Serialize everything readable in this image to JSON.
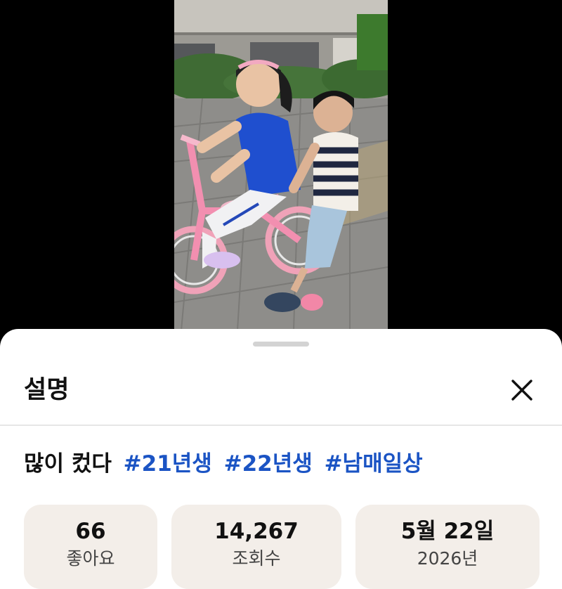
{
  "video": {
    "thumbnail_icon": "video-frame-kids-on-bicycle"
  },
  "sheet": {
    "title": "설명",
    "close_icon": "close-icon",
    "description": {
      "text": "많이 컸다",
      "hashtags": [
        "#21년생",
        "#22년생",
        "#남매일상"
      ]
    },
    "stats": [
      {
        "value": "66",
        "label": "좋아요"
      },
      {
        "value": "14,267",
        "label": "조회수"
      },
      {
        "value": "5월 22일",
        "label": "2026년"
      }
    ]
  },
  "colors": {
    "background": "#000000",
    "sheet": "#ffffff",
    "hashtag": "#1b54c4",
    "stat_card": "#f3eee9"
  }
}
